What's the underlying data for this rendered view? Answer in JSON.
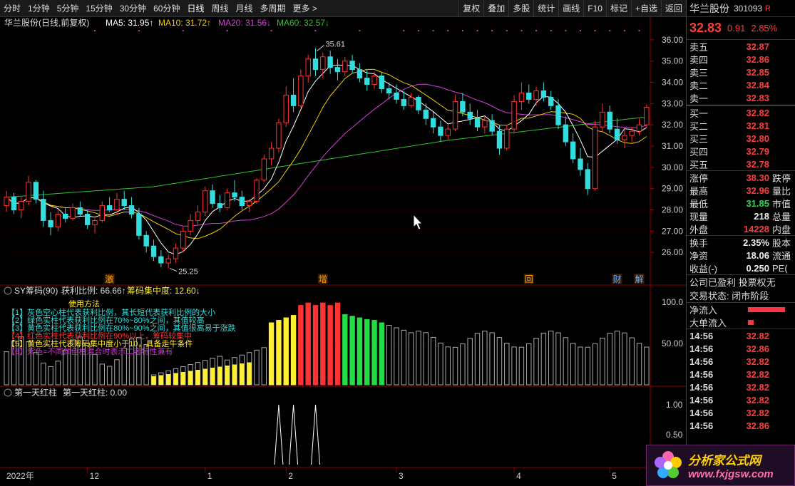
{
  "toolbar": {
    "periods": [
      "分时",
      "1分钟",
      "5分钟",
      "15分钟",
      "30分钟",
      "60分钟",
      "日线",
      "周线",
      "月线",
      "多周期",
      "更多 >"
    ],
    "active_period": "日线",
    "tools": [
      "复权",
      "叠加",
      "多股",
      "统计",
      "画线",
      "F10",
      "标记",
      "+自选",
      "返回"
    ]
  },
  "main_chart": {
    "title": "华兰股份(日线,前复权)",
    "ma5": "MA5: 31.95↑",
    "ma10": "MA10: 31.72↑",
    "ma20": "MA20: 31.56↓",
    "ma60": "MA60: 32.57↓",
    "high_label": "35.61",
    "low_label": "25.25",
    "y_ticks": [
      "36.00",
      "35.00",
      "34.00",
      "33.00",
      "32.00",
      "31.00",
      "30.00",
      "29.00",
      "28.00",
      "27.00",
      "26.00"
    ],
    "markers": [
      "激",
      "增",
      "回",
      "财",
      "解"
    ],
    "colors": {
      "ma5": "#ffffff",
      "ma10": "#f0d000",
      "ma20": "#d040d0",
      "ma60": "#30c030",
      "up": "#ff3333",
      "down": "#33dddd"
    }
  },
  "chip_panel": {
    "title": "SY筹码(90)",
    "profit_ratio": "获利比例: 66.66↑",
    "concentration": "筹码集中度: 12.60↓",
    "usage_title": "使用方法",
    "notes": [
      "【1】灰色空心柱代表获利比例，其长短代表获利比例的大小",
      "【2】绿色实柱代表获利比例在70%~80%之间，其值较高",
      "【3】黄色实柱代表获利比例在80%~90%之间，其值很高易于涨跌",
      "【4】红色实柱代表获利比例在90%以上，筹码较集中",
      "【5】黄色实柱代表筹码集中度小于10，具备走牛条件",
      "【6】紫色=不同颜色柱混合时表示二者特性兼有"
    ],
    "y_ticks": [
      "100.0",
      "50.00"
    ]
  },
  "red_panel": {
    "title": "第一天红柱",
    "value": "第一天红柱: 0.00",
    "y_ticks": [
      "1.00",
      "0.50"
    ]
  },
  "x_axis": [
    "2022年",
    "12",
    "1",
    "2",
    "3",
    "4",
    "5"
  ],
  "quote": {
    "name": "华兰股份",
    "code": "301093",
    "flag": "R",
    "price": "32.83",
    "change": "0.91",
    "pct": "2.85%",
    "asks": [
      {
        "label": "卖五",
        "price": "32.87"
      },
      {
        "label": "卖四",
        "price": "32.86"
      },
      {
        "label": "卖三",
        "price": "32.85"
      },
      {
        "label": "卖二",
        "price": "32.84"
      },
      {
        "label": "卖一",
        "price": "32.83"
      }
    ],
    "bids": [
      {
        "label": "买一",
        "price": "32.82"
      },
      {
        "label": "买二",
        "price": "32.81"
      },
      {
        "label": "买三",
        "price": "32.80"
      },
      {
        "label": "买四",
        "price": "32.79"
      },
      {
        "label": "买五",
        "price": "32.78"
      }
    ],
    "stats": [
      {
        "label": "涨停",
        "value": "38.30",
        "color": "red",
        "extra": "跌停"
      },
      {
        "label": "最高",
        "value": "32.96",
        "color": "red",
        "extra": "量比"
      },
      {
        "label": "最低",
        "value": "31.85",
        "color": "green",
        "extra": "市值"
      },
      {
        "label": "现量",
        "value": "218",
        "color": "white",
        "extra": "总量"
      },
      {
        "label": "外盘",
        "value": "14228",
        "color": "red",
        "extra": "内盘"
      }
    ],
    "stats2": [
      {
        "label": "换手",
        "value": "2.35%",
        "color": "white",
        "extra": "股本"
      },
      {
        "label": "净资",
        "value": "18.06",
        "color": "white",
        "extra": "流通"
      },
      {
        "label": "收益(-)",
        "value": "0.250",
        "color": "white",
        "extra": "PE("
      }
    ],
    "info": [
      "公司已盈利 投票权无",
      "交易状态: 闭市阶段"
    ],
    "flows": [
      {
        "label": "净流入"
      },
      {
        "label": "大单流入"
      }
    ],
    "flow_fraction": [
      0.52,
      0.08
    ],
    "ticks": [
      {
        "time": "14:56",
        "price": "32.82"
      },
      {
        "time": "14:56",
        "price": "32.86"
      },
      {
        "time": "14:56",
        "price": "32.82"
      },
      {
        "time": "14:56",
        "price": "32.82"
      },
      {
        "time": "14:56",
        "price": "32.82"
      },
      {
        "time": "14:56",
        "price": "32.82"
      },
      {
        "time": "14:56",
        "price": "32.82"
      },
      {
        "time": "14:56",
        "price": "32.86"
      }
    ]
  },
  "logo": {
    "text": "分析家公式网",
    "url": "www.fxjgsw.com"
  },
  "chart_data": {
    "type": "candlestick",
    "ohlc_approx": [
      [
        28.2,
        28.9,
        27.9,
        28.6
      ],
      [
        28.6,
        28.8,
        27.8,
        28.0
      ],
      [
        28.0,
        28.6,
        27.6,
        28.4
      ],
      [
        28.4,
        29.6,
        28.2,
        29.3
      ],
      [
        29.3,
        29.4,
        28.3,
        28.5
      ],
      [
        28.5,
        28.9,
        27.2,
        27.5
      ],
      [
        27.5,
        27.9,
        26.8,
        27.2
      ],
      [
        27.2,
        28.0,
        27.0,
        27.8
      ],
      [
        27.8,
        28.1,
        27.4,
        27.6
      ],
      [
        27.6,
        28.3,
        27.5,
        28.1
      ],
      [
        28.1,
        28.4,
        27.7,
        27.8
      ],
      [
        27.8,
        28.0,
        27.1,
        27.3
      ],
      [
        27.3,
        27.6,
        26.9,
        27.5
      ],
      [
        27.5,
        28.4,
        27.4,
        28.2
      ],
      [
        28.2,
        28.6,
        27.9,
        28.0
      ],
      [
        28.0,
        28.8,
        27.8,
        28.5
      ],
      [
        28.5,
        28.9,
        28.0,
        28.2
      ],
      [
        28.2,
        28.6,
        27.6,
        27.8
      ],
      [
        27.8,
        28.1,
        26.6,
        26.8
      ],
      [
        26.8,
        27.0,
        26.0,
        26.3
      ],
      [
        26.3,
        26.6,
        25.6,
        25.8
      ],
      [
        25.8,
        26.1,
        25.3,
        25.5
      ],
      [
        25.5,
        25.9,
        25.25,
        25.7
      ],
      [
        25.7,
        26.4,
        25.5,
        26.2
      ],
      [
        26.2,
        27.2,
        26.0,
        27.0
      ],
      [
        27.0,
        27.8,
        26.8,
        27.5
      ],
      [
        27.5,
        28.2,
        27.3,
        27.9
      ],
      [
        27.9,
        29.1,
        27.7,
        28.9
      ],
      [
        28.9,
        29.2,
        28.1,
        28.3
      ],
      [
        28.3,
        28.7,
        27.9,
        28.1
      ],
      [
        28.1,
        29.0,
        28.0,
        28.8
      ],
      [
        28.8,
        29.4,
        28.4,
        28.6
      ],
      [
        28.6,
        28.9,
        28.0,
        28.2
      ],
      [
        28.2,
        28.5,
        27.9,
        28.4
      ],
      [
        28.4,
        29.5,
        28.3,
        29.4
      ],
      [
        29.4,
        30.6,
        29.3,
        30.4
      ],
      [
        30.4,
        31.2,
        30.1,
        30.9
      ],
      [
        30.9,
        32.3,
        30.7,
        32.1
      ],
      [
        32.1,
        33.8,
        31.9,
        33.4
      ],
      [
        33.4,
        34.2,
        32.6,
        32.9
      ],
      [
        32.9,
        34.6,
        32.8,
        34.3
      ],
      [
        34.3,
        35.3,
        34.0,
        35.1
      ],
      [
        35.1,
        35.61,
        34.3,
        34.6
      ],
      [
        34.6,
        35.4,
        34.2,
        35.2
      ],
      [
        35.2,
        35.5,
        34.4,
        34.7
      ],
      [
        34.7,
        35.1,
        34.1,
        34.5
      ],
      [
        34.5,
        35.2,
        34.3,
        35.0
      ],
      [
        35.0,
        35.3,
        34.4,
        34.6
      ],
      [
        34.6,
        34.9,
        34.0,
        34.2
      ],
      [
        34.2,
        34.6,
        33.6,
        33.9
      ],
      [
        33.9,
        34.5,
        33.7,
        34.3
      ],
      [
        34.3,
        34.5,
        33.5,
        33.7
      ],
      [
        33.7,
        34.0,
        33.2,
        33.5
      ],
      [
        33.5,
        33.9,
        33.0,
        33.2
      ],
      [
        33.2,
        33.6,
        32.7,
        32.9
      ],
      [
        32.9,
        33.5,
        32.8,
        33.3
      ],
      [
        33.3,
        33.4,
        32.5,
        32.7
      ],
      [
        32.7,
        33.0,
        32.0,
        32.3
      ],
      [
        32.3,
        32.6,
        31.6,
        31.9
      ],
      [
        31.9,
        32.2,
        31.2,
        31.5
      ],
      [
        31.5,
        32.0,
        31.3,
        31.8
      ],
      [
        31.8,
        33.4,
        31.7,
        33.1
      ],
      [
        33.1,
        33.5,
        32.4,
        32.6
      ],
      [
        32.6,
        33.0,
        32.0,
        32.3
      ],
      [
        32.3,
        32.7,
        31.7,
        31.9
      ],
      [
        31.9,
        32.4,
        31.6,
        32.2
      ],
      [
        32.2,
        32.5,
        31.5,
        31.7
      ],
      [
        31.7,
        32.0,
        30.6,
        30.9
      ],
      [
        30.9,
        32.0,
        30.8,
        31.8
      ],
      [
        31.8,
        33.4,
        31.6,
        33.1
      ],
      [
        33.1,
        34.0,
        32.7,
        33.5
      ],
      [
        33.5,
        33.9,
        33.0,
        33.2
      ],
      [
        33.2,
        33.8,
        32.9,
        33.6
      ],
      [
        33.6,
        34.0,
        33.1,
        33.3
      ],
      [
        33.3,
        33.6,
        32.7,
        32.9
      ],
      [
        32.9,
        33.2,
        31.8,
        32.0
      ],
      [
        32.0,
        32.4,
        31.0,
        31.2
      ],
      [
        31.2,
        31.6,
        30.2,
        30.4
      ],
      [
        30.4,
        30.9,
        29.6,
        29.9
      ],
      [
        29.9,
        30.2,
        28.7,
        29.0
      ],
      [
        29.0,
        32.2,
        28.9,
        31.9
      ],
      [
        31.9,
        33.0,
        31.7,
        32.6
      ],
      [
        32.6,
        32.9,
        31.6,
        31.8
      ],
      [
        31.8,
        32.3,
        31.1,
        31.3
      ],
      [
        31.3,
        31.8,
        30.9,
        31.5
      ],
      [
        31.5,
        31.9,
        31.2,
        31.7
      ],
      [
        31.7,
        32.3,
        31.5,
        32.0
      ],
      [
        32.0,
        32.96,
        31.85,
        32.83
      ]
    ],
    "ma_series": [
      "MA5",
      "MA10",
      "MA20",
      "MA60"
    ]
  }
}
